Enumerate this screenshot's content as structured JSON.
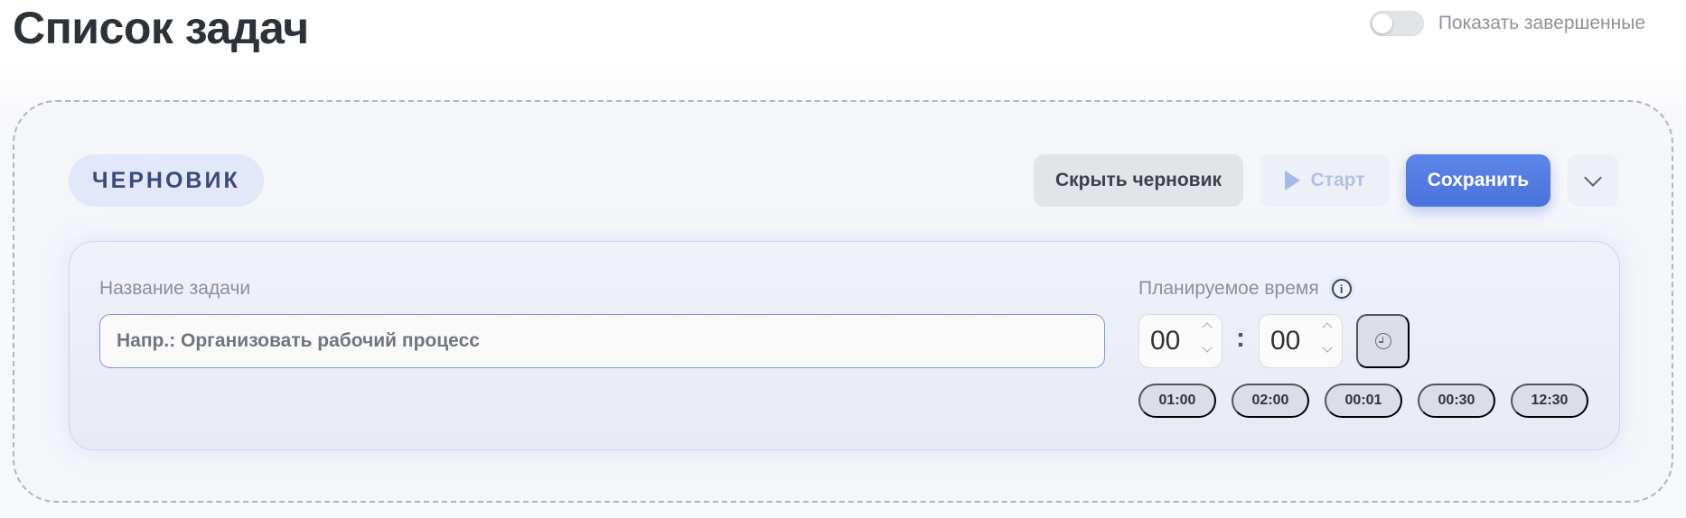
{
  "header": {
    "title": "Список задач",
    "show_completed_label": "Показать завершенные",
    "show_completed_on": false
  },
  "draft": {
    "badge": "ЧЕРНОВИК",
    "actions": {
      "hide_label": "Скрыть черновик",
      "start_label": "Старт",
      "save_label": "Сохранить"
    },
    "form": {
      "name_label": "Название задачи",
      "name_placeholder": "Напр.: Организовать рабочий процесс",
      "name_value": "",
      "time_label": "Планируемое время",
      "hours": "00",
      "minutes": "00",
      "separator": ":",
      "presets": [
        "01:00",
        "02:00",
        "00:01",
        "00:30",
        "12:30"
      ]
    }
  },
  "colors": {
    "accent": "#4f78e0",
    "badge_bg": "#e2e7f9",
    "badge_text": "#3b4a7c"
  },
  "icons": {
    "info": "info-icon",
    "clock": "clock-icon",
    "play": "play-icon",
    "chevron": "chevron-down-icon"
  }
}
